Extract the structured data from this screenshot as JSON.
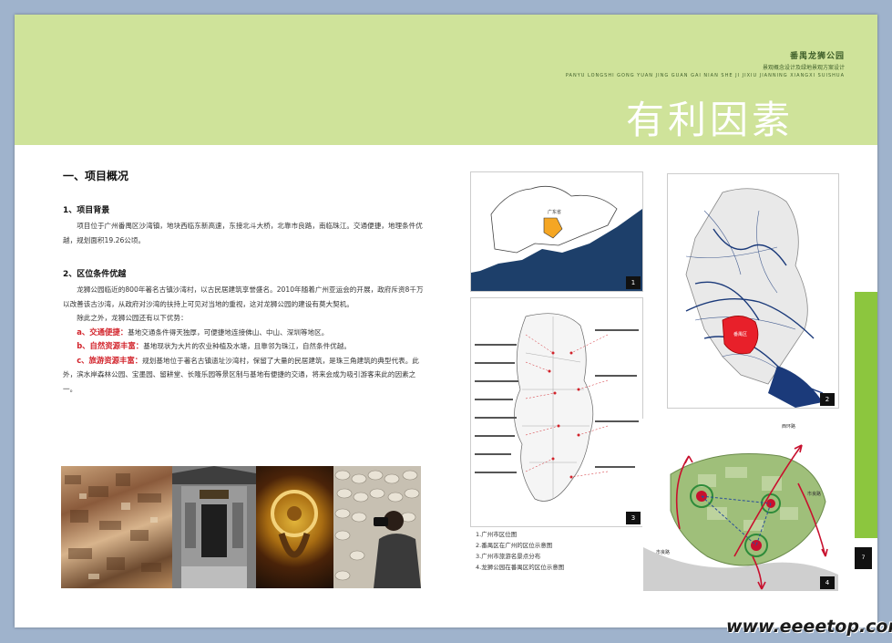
{
  "header": {
    "project_name": "番禺龙狮公园",
    "project_subtitle": "景观概念设计及绿地景观方案设计",
    "project_pinyin": "PANYU LONGSHI GONG YUAN JING GUAN GAI NIAN SHE JI JIXIU JIANNING XIANGXI SUISHUA",
    "page_title": "有利因素"
  },
  "section": {
    "title": "一、项目概况",
    "sub1_title": "1、项目背景",
    "sub1_text": "项目位于广州番禺区沙湾镇，地块西临东新高速，东接北斗大桥，北靠市良路，南临珠江。交通便捷，地理条件优越，规划面积19.26公顷。",
    "sub2_title": "2、区位条件优越",
    "sub2_text1": "龙狮公园临近的800年著名古镇沙湾村，以古民居建筑享誉盛名。2010年随着广州亚运会的开展，政府斥资8千万以改善该古沙湾，从政府对沙湾的扶持上可见对当地的重视，这对龙狮公园的建设有莫大契机。",
    "sub2_text2": "除此之外，龙狮公园还有以下优势：",
    "item_a_label": "a、交通便捷：",
    "item_a_text": "基地交通条件得天独厚，可便捷地连接佛山、中山、深圳等地区。",
    "item_b_label": "b、自然资源丰富：",
    "item_b_text": "基地现状为大片的农业种植及水塘，且靠邻为珠江，自然条件优越。",
    "item_c_label": "c、旅游资源丰富：",
    "item_c_text": "规划基地位于著名古镇遗址沙湾村，保留了大量的民居建筑，是珠三角建筑的典型代表。此外，滨水岸森林公园、宝墨园、留耕堂、长隆乐园等景区制与基地有便捷的交通，将来会成为吸引游客来此的因素之一。"
  },
  "figures": {
    "badge1": "1",
    "badge2": "2",
    "badge3": "3",
    "badge4": "4",
    "map1_label": "广东省",
    "map2_label": "番禺区",
    "map4_road1": "西环路",
    "map4_road2": "市良路",
    "map4_road3": "市良路"
  },
  "captions": [
    "1.广州市区位图",
    "2.番禺区在广州的区位示意图",
    "3.广州市旅游名景点分布",
    "4.龙狮公园在番禺区的区位示意图"
  ],
  "page_number": "7",
  "watermark": "www.eeeetop.com",
  "colors": {
    "banner": "#cfe39a",
    "accent_green": "#8cc63e",
    "highlight_red": "#d2222a"
  }
}
